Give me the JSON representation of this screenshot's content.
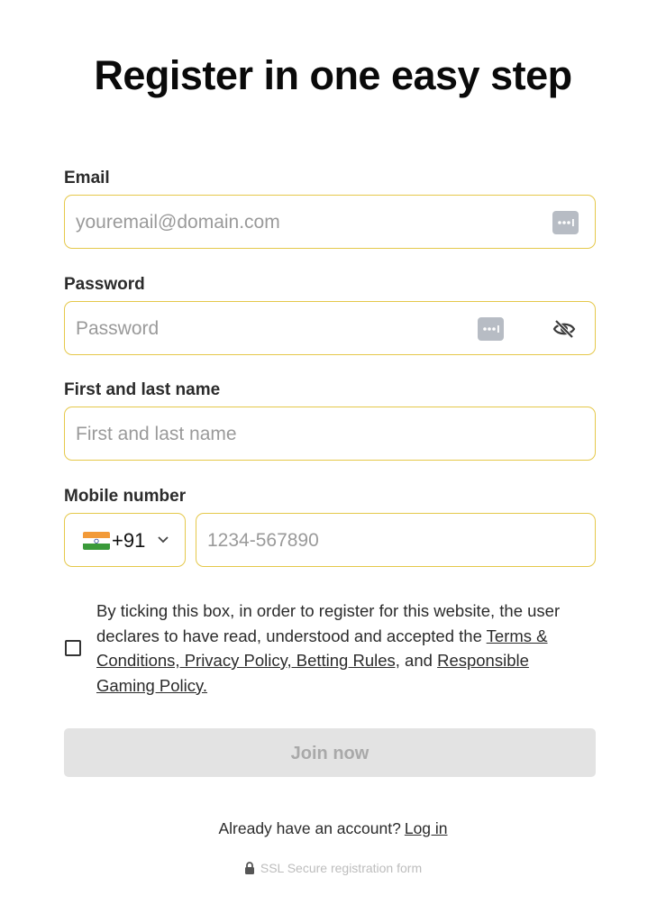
{
  "page": {
    "title": "Register in one easy step"
  },
  "email": {
    "label": "Email",
    "placeholder": "youremail@domain.com",
    "value": ""
  },
  "password": {
    "label": "Password",
    "placeholder": "Password",
    "value": ""
  },
  "name": {
    "label": "First and last name",
    "placeholder": "First and last name",
    "value": ""
  },
  "mobile": {
    "label": "Mobile number",
    "country_code": "+91",
    "flag": "india-flag",
    "placeholder": "1234-567890",
    "value": ""
  },
  "consent": {
    "checked": false,
    "text_before": "By ticking this box, in order to register for this website, the user declares to have read, understood and accepted the ",
    "link_terms": "Terms & Conditions, Privacy Policy, Betting Rules,",
    "text_and": " and ",
    "link_responsible": "Responsible Gaming Policy."
  },
  "join_button": {
    "label": "Join now"
  },
  "login_prompt": {
    "text": "Already have an account?",
    "link": "Log in"
  },
  "ssl": {
    "text": "SSL Secure registration form",
    "icon": "lock-icon"
  },
  "colors": {
    "field_border": "#e5c84a",
    "button_disabled_bg": "#e3e3e3",
    "button_disabled_text": "#a9a9a9",
    "title": "#0a0a0a"
  }
}
